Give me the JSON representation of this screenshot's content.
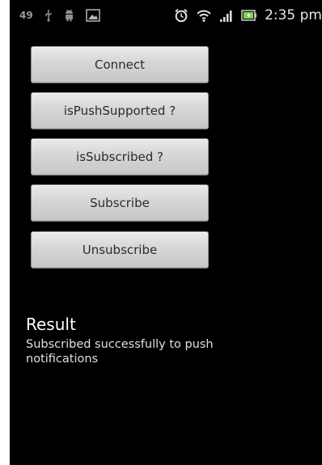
{
  "statusbar": {
    "notification_count": "49",
    "time": "2:35 pm",
    "icons": [
      "usb-icon",
      "android-debug-icon",
      "image-notification-icon",
      "alarm-icon",
      "wifi-icon",
      "signal-icon",
      "battery-icon"
    ]
  },
  "buttons": {
    "connect": "Connect",
    "is_push_supported": "isPushSupported ?",
    "is_subscribed": "isSubscribed ?",
    "subscribe": "Subscribe",
    "unsubscribe": "Unsubscribe"
  },
  "result": {
    "title": "Result",
    "message": "Subscribed successfully to push notifications"
  }
}
